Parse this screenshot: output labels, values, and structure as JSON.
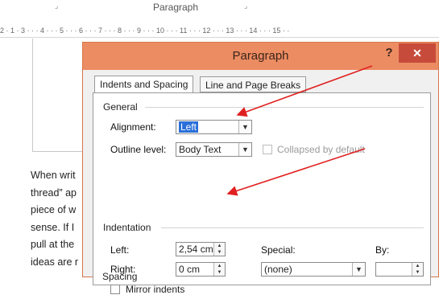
{
  "ribbon": {
    "group_label": "Paragraph",
    "ruler_numbers": "2 · 1 · 3 · · · 4 · · · 5 · · · 6 · · · 7 · · · 8 · · · 9 · · · 10 · · · 11 · · · 12 · · · 13 · · · 14 · · · 15 · ·"
  },
  "document": {
    "lines": [
      "When writ",
      "thread” ap",
      "piece of w",
      "sense. If I",
      "pull at the",
      "ideas are r"
    ]
  },
  "dialog": {
    "title": "Paragraph",
    "help": "?",
    "close": "✕",
    "tabs": [
      "Indents and Spacing",
      "Line and Page Breaks"
    ],
    "general": {
      "section": "General",
      "alignment_label": "Alignment:",
      "alignment_value": "Left",
      "outline_label": "Outline level:",
      "outline_value": "Body Text",
      "collapsed_label": "Collapsed by default"
    },
    "indentation": {
      "section": "Indentation",
      "left_label": "Left:",
      "left_value": "2,54 cm",
      "right_label": "Right:",
      "right_value": "0 cm",
      "special_label": "Special:",
      "special_value": "(none)",
      "by_label": "By:",
      "by_value": "",
      "mirror_label": "Mirror indents"
    },
    "spacing": {
      "section": "Spacing"
    }
  },
  "colors": {
    "titlebar": "#ec8c63",
    "close": "#c74b3a",
    "highlight": "#2a6fd9",
    "annotation_arrow": "#e02020"
  }
}
